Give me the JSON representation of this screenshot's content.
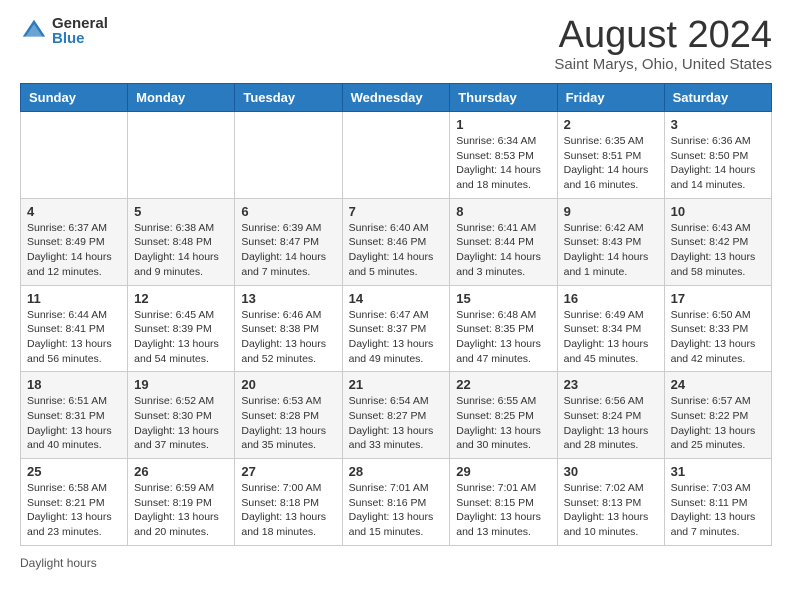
{
  "header": {
    "logo": {
      "general": "General",
      "blue": "Blue"
    },
    "title": "August 2024",
    "location": "Saint Marys, Ohio, United States"
  },
  "days_of_week": [
    "Sunday",
    "Monday",
    "Tuesday",
    "Wednesday",
    "Thursday",
    "Friday",
    "Saturday"
  ],
  "weeks": [
    [
      {
        "day": "",
        "info": ""
      },
      {
        "day": "",
        "info": ""
      },
      {
        "day": "",
        "info": ""
      },
      {
        "day": "",
        "info": ""
      },
      {
        "day": "1",
        "info": "Sunrise: 6:34 AM\nSunset: 8:53 PM\nDaylight: 14 hours\nand 18 minutes."
      },
      {
        "day": "2",
        "info": "Sunrise: 6:35 AM\nSunset: 8:51 PM\nDaylight: 14 hours\nand 16 minutes."
      },
      {
        "day": "3",
        "info": "Sunrise: 6:36 AM\nSunset: 8:50 PM\nDaylight: 14 hours\nand 14 minutes."
      }
    ],
    [
      {
        "day": "4",
        "info": "Sunrise: 6:37 AM\nSunset: 8:49 PM\nDaylight: 14 hours\nand 12 minutes."
      },
      {
        "day": "5",
        "info": "Sunrise: 6:38 AM\nSunset: 8:48 PM\nDaylight: 14 hours\nand 9 minutes."
      },
      {
        "day": "6",
        "info": "Sunrise: 6:39 AM\nSunset: 8:47 PM\nDaylight: 14 hours\nand 7 minutes."
      },
      {
        "day": "7",
        "info": "Sunrise: 6:40 AM\nSunset: 8:46 PM\nDaylight: 14 hours\nand 5 minutes."
      },
      {
        "day": "8",
        "info": "Sunrise: 6:41 AM\nSunset: 8:44 PM\nDaylight: 14 hours\nand 3 minutes."
      },
      {
        "day": "9",
        "info": "Sunrise: 6:42 AM\nSunset: 8:43 PM\nDaylight: 14 hours\nand 1 minute."
      },
      {
        "day": "10",
        "info": "Sunrise: 6:43 AM\nSunset: 8:42 PM\nDaylight: 13 hours\nand 58 minutes."
      }
    ],
    [
      {
        "day": "11",
        "info": "Sunrise: 6:44 AM\nSunset: 8:41 PM\nDaylight: 13 hours\nand 56 minutes."
      },
      {
        "day": "12",
        "info": "Sunrise: 6:45 AM\nSunset: 8:39 PM\nDaylight: 13 hours\nand 54 minutes."
      },
      {
        "day": "13",
        "info": "Sunrise: 6:46 AM\nSunset: 8:38 PM\nDaylight: 13 hours\nand 52 minutes."
      },
      {
        "day": "14",
        "info": "Sunrise: 6:47 AM\nSunset: 8:37 PM\nDaylight: 13 hours\nand 49 minutes."
      },
      {
        "day": "15",
        "info": "Sunrise: 6:48 AM\nSunset: 8:35 PM\nDaylight: 13 hours\nand 47 minutes."
      },
      {
        "day": "16",
        "info": "Sunrise: 6:49 AM\nSunset: 8:34 PM\nDaylight: 13 hours\nand 45 minutes."
      },
      {
        "day": "17",
        "info": "Sunrise: 6:50 AM\nSunset: 8:33 PM\nDaylight: 13 hours\nand 42 minutes."
      }
    ],
    [
      {
        "day": "18",
        "info": "Sunrise: 6:51 AM\nSunset: 8:31 PM\nDaylight: 13 hours\nand 40 minutes."
      },
      {
        "day": "19",
        "info": "Sunrise: 6:52 AM\nSunset: 8:30 PM\nDaylight: 13 hours\nand 37 minutes."
      },
      {
        "day": "20",
        "info": "Sunrise: 6:53 AM\nSunset: 8:28 PM\nDaylight: 13 hours\nand 35 minutes."
      },
      {
        "day": "21",
        "info": "Sunrise: 6:54 AM\nSunset: 8:27 PM\nDaylight: 13 hours\nand 33 minutes."
      },
      {
        "day": "22",
        "info": "Sunrise: 6:55 AM\nSunset: 8:25 PM\nDaylight: 13 hours\nand 30 minutes."
      },
      {
        "day": "23",
        "info": "Sunrise: 6:56 AM\nSunset: 8:24 PM\nDaylight: 13 hours\nand 28 minutes."
      },
      {
        "day": "24",
        "info": "Sunrise: 6:57 AM\nSunset: 8:22 PM\nDaylight: 13 hours\nand 25 minutes."
      }
    ],
    [
      {
        "day": "25",
        "info": "Sunrise: 6:58 AM\nSunset: 8:21 PM\nDaylight: 13 hours\nand 23 minutes."
      },
      {
        "day": "26",
        "info": "Sunrise: 6:59 AM\nSunset: 8:19 PM\nDaylight: 13 hours\nand 20 minutes."
      },
      {
        "day": "27",
        "info": "Sunrise: 7:00 AM\nSunset: 8:18 PM\nDaylight: 13 hours\nand 18 minutes."
      },
      {
        "day": "28",
        "info": "Sunrise: 7:01 AM\nSunset: 8:16 PM\nDaylight: 13 hours\nand 15 minutes."
      },
      {
        "day": "29",
        "info": "Sunrise: 7:01 AM\nSunset: 8:15 PM\nDaylight: 13 hours\nand 13 minutes."
      },
      {
        "day": "30",
        "info": "Sunrise: 7:02 AM\nSunset: 8:13 PM\nDaylight: 13 hours\nand 10 minutes."
      },
      {
        "day": "31",
        "info": "Sunrise: 7:03 AM\nSunset: 8:11 PM\nDaylight: 13 hours\nand 7 minutes."
      }
    ]
  ],
  "footer": {
    "daylight_hours_label": "Daylight hours"
  }
}
